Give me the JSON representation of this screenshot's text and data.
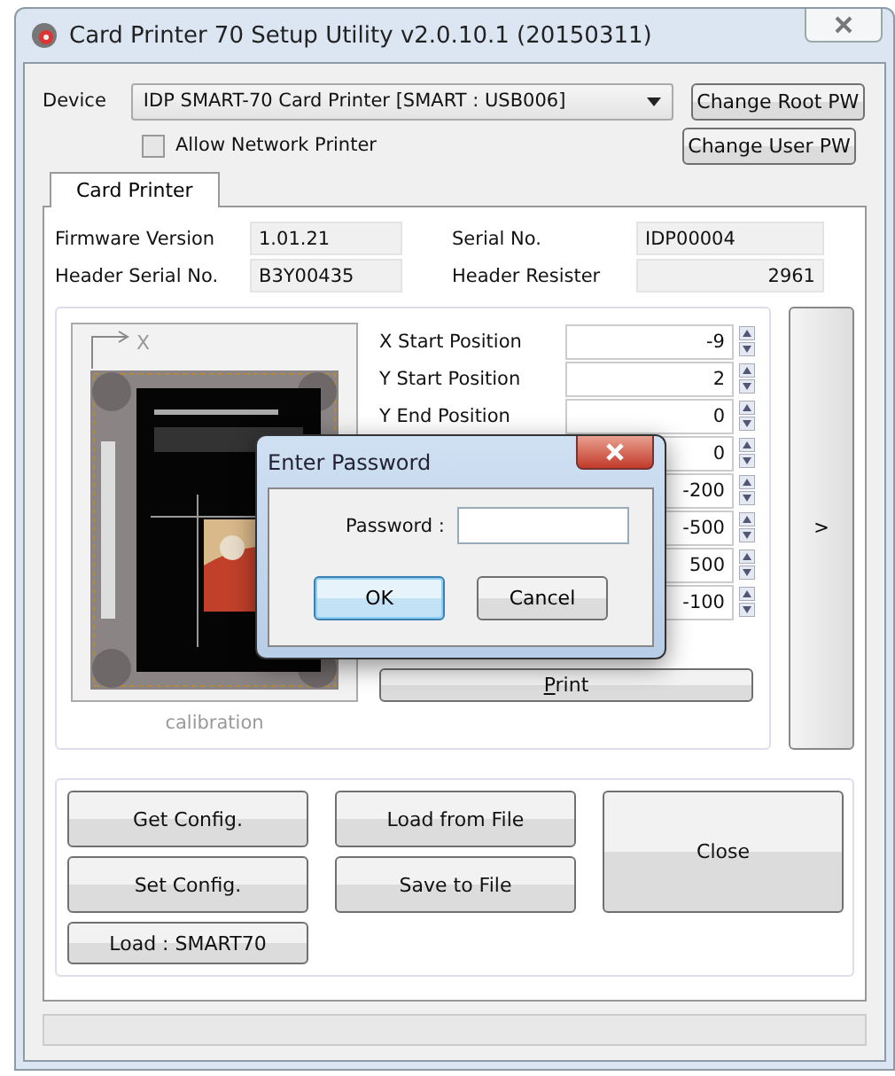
{
  "window": {
    "title": "Card Printer 70 Setup Utility v2.0.10.1 (20150311)"
  },
  "device": {
    "label": "Device",
    "value": "IDP SMART-70 Card Printer  [SMART : USB006]",
    "allow_network": {
      "label": "Allow Network Printer",
      "checked": false
    }
  },
  "side_buttons": [
    "Change Root PW",
    "Change User PW"
  ],
  "tabs": [
    {
      "label": "Card Printer",
      "selected": true
    }
  ],
  "info": [
    {
      "label": "Firmware Version",
      "value": "1.01.21",
      "right_aligned": false
    },
    {
      "label": "Serial No.",
      "value": "IDP00004",
      "right_aligned": false
    },
    {
      "label": "Header Serial No.",
      "value": "B3Y00435",
      "right_aligned": false
    },
    {
      "label": "Header Resister",
      "value": "2961",
      "right_aligned": true
    }
  ],
  "calibration": {
    "axis_label": "X",
    "caption": "calibration"
  },
  "positions": [
    {
      "label": "X Start Position",
      "value": "-9"
    },
    {
      "label": "Y Start Position",
      "value": "2"
    },
    {
      "label": "Y End Position",
      "value": "0"
    },
    {
      "value": "0"
    },
    {
      "value": "-200"
    },
    {
      "value": "-500"
    },
    {
      "value": "500"
    },
    {
      "value": "-100"
    }
  ],
  "print_button": {
    "label": "Print"
  },
  "next_button": ">",
  "actions": [
    {
      "label": "Get Config."
    },
    {
      "label": "Load from File"
    },
    {
      "label": "Set Config."
    },
    {
      "label": "Save to File"
    },
    {
      "label": "Load : SMART70"
    }
  ],
  "close_button": "Close",
  "dialog": {
    "title": "Enter Password",
    "field_label": "Password :",
    "buttons": [
      {
        "label": "OK",
        "selected": true
      },
      {
        "label": "Cancel",
        "selected": false
      }
    ]
  }
}
